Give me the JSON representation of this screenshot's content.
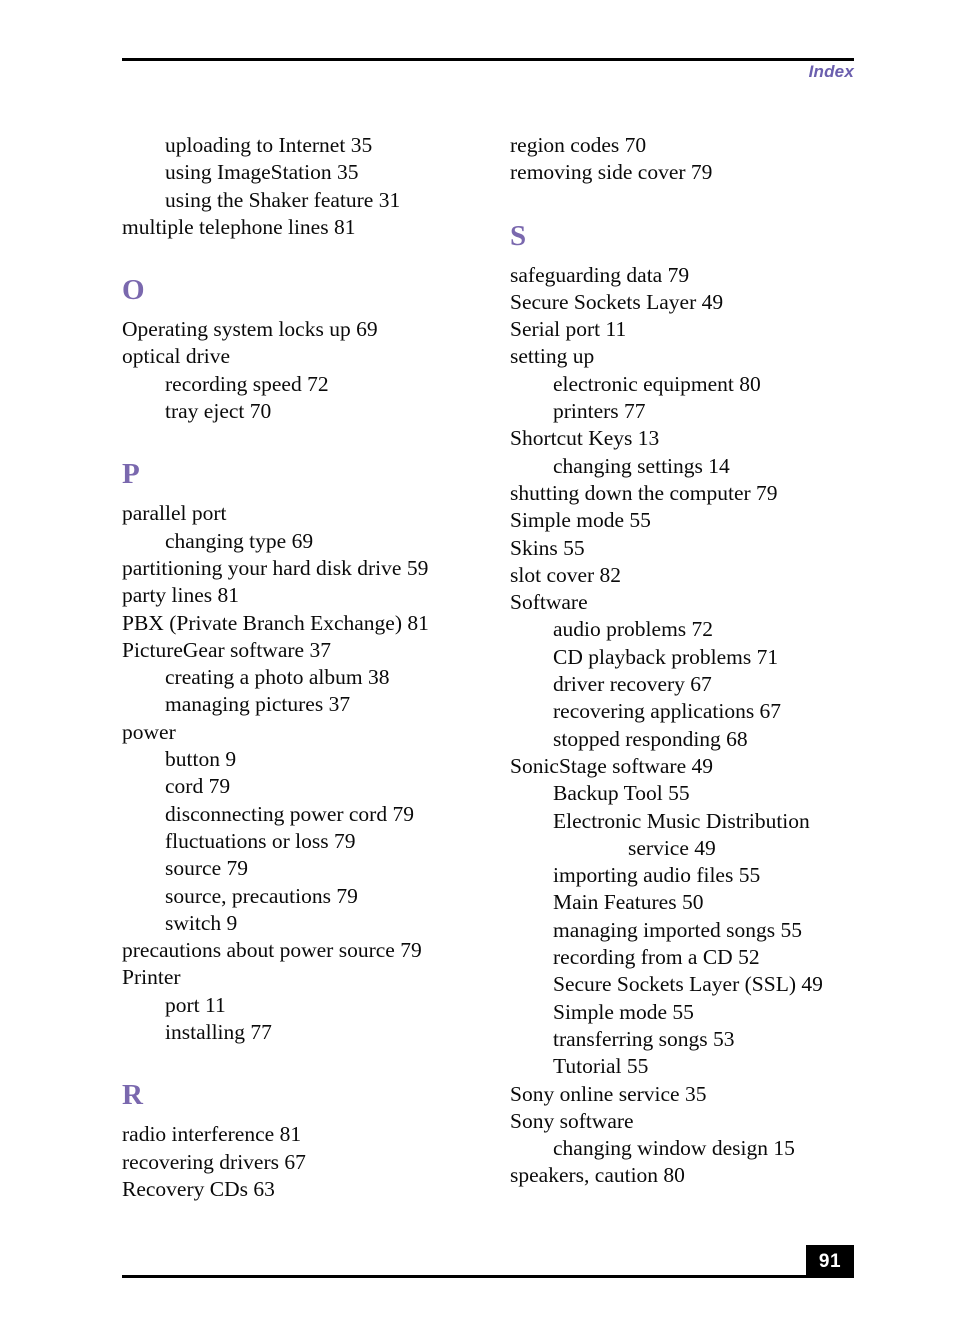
{
  "header": {
    "label": "Index",
    "accent_color": "#6b5fae"
  },
  "footer": {
    "page_number": "91",
    "badge_background": "#000000",
    "badge_text_color": "#ffffff"
  },
  "section_letter_color": "#7a68ae",
  "columns": {
    "left": [
      {
        "kind": "entry",
        "level": 1,
        "text": "uploading to Internet 35"
      },
      {
        "kind": "entry",
        "level": 1,
        "text": "using ImageStation 35"
      },
      {
        "kind": "entry",
        "level": 1,
        "text": "using the Shaker feature 31"
      },
      {
        "kind": "entry",
        "level": 0,
        "text": "multiple telephone lines 81"
      },
      {
        "kind": "section",
        "text": "O"
      },
      {
        "kind": "entry",
        "level": 0,
        "text": "Operating system locks up 69"
      },
      {
        "kind": "entry",
        "level": 0,
        "text": "optical drive"
      },
      {
        "kind": "entry",
        "level": 1,
        "text": "recording speed 72"
      },
      {
        "kind": "entry",
        "level": 1,
        "text": "tray eject 70"
      },
      {
        "kind": "section",
        "text": "P"
      },
      {
        "kind": "entry",
        "level": 0,
        "text": "parallel port"
      },
      {
        "kind": "entry",
        "level": 1,
        "text": "changing type 69"
      },
      {
        "kind": "entry",
        "level": 0,
        "text": "partitioning your hard disk drive 59"
      },
      {
        "kind": "entry",
        "level": 0,
        "text": "party lines 81"
      },
      {
        "kind": "entry",
        "level": 0,
        "text": "PBX (Private Branch Exchange) 81"
      },
      {
        "kind": "entry",
        "level": 0,
        "text": "PictureGear software 37"
      },
      {
        "kind": "entry",
        "level": 1,
        "text": "creating a photo album 38"
      },
      {
        "kind": "entry",
        "level": 1,
        "text": "managing pictures 37"
      },
      {
        "kind": "entry",
        "level": 0,
        "text": "power"
      },
      {
        "kind": "entry",
        "level": 1,
        "text": "button 9"
      },
      {
        "kind": "entry",
        "level": 1,
        "text": "cord 79"
      },
      {
        "kind": "entry",
        "level": 1,
        "text": "disconnecting power cord 79"
      },
      {
        "kind": "entry",
        "level": 1,
        "text": "fluctuations or loss 79"
      },
      {
        "kind": "entry",
        "level": 1,
        "text": "source 79"
      },
      {
        "kind": "entry",
        "level": 1,
        "text": "source, precautions 79"
      },
      {
        "kind": "entry",
        "level": 1,
        "text": "switch 9"
      },
      {
        "kind": "entry",
        "level": 0,
        "text": "precautions about power source 79"
      },
      {
        "kind": "entry",
        "level": 0,
        "text": "Printer"
      },
      {
        "kind": "entry",
        "level": 1,
        "text": "port 11"
      },
      {
        "kind": "entry",
        "level": 1,
        "text": "installing 77"
      },
      {
        "kind": "section",
        "text": "R"
      },
      {
        "kind": "entry",
        "level": 0,
        "text": "radio interference 81"
      },
      {
        "kind": "entry",
        "level": 0,
        "text": "recovering drivers 67"
      },
      {
        "kind": "entry",
        "level": 0,
        "text": "Recovery CDs 63"
      }
    ],
    "right": [
      {
        "kind": "entry",
        "level": 0,
        "text": "region codes 70"
      },
      {
        "kind": "entry",
        "level": 0,
        "text": "removing side cover 79"
      },
      {
        "kind": "section",
        "text": "S"
      },
      {
        "kind": "entry",
        "level": 0,
        "text": "safeguarding data 79"
      },
      {
        "kind": "entry",
        "level": 0,
        "text": "Secure Sockets Layer 49"
      },
      {
        "kind": "entry",
        "level": 0,
        "text": "Serial port 11"
      },
      {
        "kind": "entry",
        "level": 0,
        "text": "setting up"
      },
      {
        "kind": "entry",
        "level": 1,
        "text": "electronic equipment 80"
      },
      {
        "kind": "entry",
        "level": 1,
        "text": "printers 77"
      },
      {
        "kind": "entry",
        "level": 0,
        "text": "Shortcut Keys 13"
      },
      {
        "kind": "entry",
        "level": 1,
        "text": "changing settings 14"
      },
      {
        "kind": "entry",
        "level": 0,
        "text": "shutting down the computer 79"
      },
      {
        "kind": "entry",
        "level": 0,
        "text": "Simple mode 55"
      },
      {
        "kind": "entry",
        "level": 0,
        "text": "Skins 55"
      },
      {
        "kind": "entry",
        "level": 0,
        "text": "slot cover 82"
      },
      {
        "kind": "entry",
        "level": 0,
        "text": "Software"
      },
      {
        "kind": "entry",
        "level": 1,
        "text": "audio problems 72"
      },
      {
        "kind": "entry",
        "level": 1,
        "text": "CD playback problems 71"
      },
      {
        "kind": "entry",
        "level": 1,
        "text": "driver recovery 67"
      },
      {
        "kind": "entry",
        "level": 1,
        "text": "recovering applications 67"
      },
      {
        "kind": "entry",
        "level": 1,
        "text": "stopped responding 68"
      },
      {
        "kind": "entry",
        "level": 0,
        "text": "SonicStage software 49"
      },
      {
        "kind": "entry",
        "level": 1,
        "text": "Backup Tool 55"
      },
      {
        "kind": "entry",
        "level": 1,
        "text": "Electronic Music Distribution"
      },
      {
        "kind": "entry",
        "level": 2,
        "text": "service 49"
      },
      {
        "kind": "entry",
        "level": 1,
        "text": "importing audio files 55"
      },
      {
        "kind": "entry",
        "level": 1,
        "text": "Main Features 50"
      },
      {
        "kind": "entry",
        "level": 1,
        "text": "managing imported songs 55"
      },
      {
        "kind": "entry",
        "level": 1,
        "text": "recording from a CD 52"
      },
      {
        "kind": "entry",
        "level": 1,
        "text": "Secure Sockets Layer (SSL) 49"
      },
      {
        "kind": "entry",
        "level": 1,
        "text": "Simple mode 55"
      },
      {
        "kind": "entry",
        "level": 1,
        "text": "transferring songs 53"
      },
      {
        "kind": "entry",
        "level": 1,
        "text": "Tutorial 55"
      },
      {
        "kind": "entry",
        "level": 0,
        "text": "Sony online service 35"
      },
      {
        "kind": "entry",
        "level": 0,
        "text": "Sony software"
      },
      {
        "kind": "entry",
        "level": 1,
        "text": "changing window design 15"
      },
      {
        "kind": "entry",
        "level": 0,
        "text": "speakers, caution 80"
      }
    ]
  }
}
